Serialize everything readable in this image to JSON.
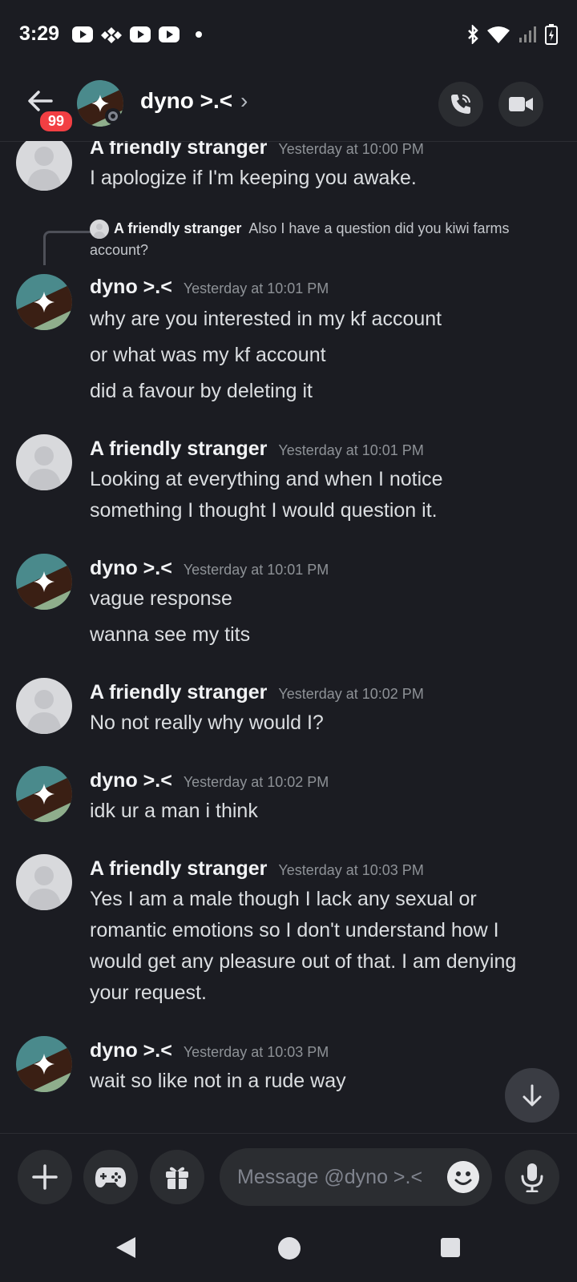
{
  "status_bar": {
    "time": "3:29"
  },
  "header": {
    "back_badge": "99",
    "contact_name": "dyno >.<",
    "chevron": "›"
  },
  "messages": [
    {
      "author": "A friendly stranger",
      "time": "Yesterday at 10:00 PM",
      "lines": [
        "I apologize if I'm keeping you awake."
      ]
    },
    {
      "reply_to": {
        "author": "A friendly stranger",
        "text": "Also I have a question did you kiwi farms account?"
      },
      "author": "dyno >.<",
      "time": "Yesterday at 10:01 PM",
      "lines": [
        "why are you interested in my kf account",
        "or what was my kf account",
        "did a favour by deleting it"
      ]
    },
    {
      "author": "A friendly stranger",
      "time": "Yesterday at 10:01 PM",
      "lines": [
        "Looking at everything and when I notice",
        "something I thought I would question it."
      ]
    },
    {
      "author": "dyno >.<",
      "time": "Yesterday at 10:01 PM",
      "lines": [
        "vague response",
        "wanna see my tits"
      ]
    },
    {
      "author": "A friendly stranger",
      "time": "Yesterday at 10:02 PM",
      "lines": [
        "No not really why would I?"
      ]
    },
    {
      "author": "dyno >.<",
      "time": "Yesterday at 10:02 PM",
      "lines": [
        "idk ur a man i think"
      ]
    },
    {
      "author": "A friendly stranger",
      "time": "Yesterday at 10:03 PM",
      "lines": [
        "Yes I am a male though I lack any sexual or",
        "romantic emotions so I don't understand how I",
        "would get any pleasure out of that. I am denying",
        "your request."
      ]
    },
    {
      "author": "dyno >.<",
      "time": "Yesterday at 10:03 PM",
      "lines": [
        "wait so like not in a rude way"
      ]
    }
  ],
  "composer": {
    "placeholder": "Message @dyno >.<"
  },
  "colors": {
    "background": "#1b1c22",
    "badge": "#f23f43",
    "avatar_teal": "#4a8a8c",
    "avatar_dark": "#3a1f14",
    "avatar_sage": "#8fae8c"
  },
  "icons": [
    "youtube-icon",
    "tidal-icon",
    "bluetooth-icon",
    "wifi-icon",
    "signal-icon",
    "battery-icon",
    "back-arrow-icon",
    "phone-icon",
    "video-camera-icon",
    "arrow-down-icon",
    "plus-icon",
    "gamepad-icon",
    "gift-icon",
    "emoji-icon",
    "microphone-icon",
    "nav-back-icon",
    "nav-home-icon",
    "nav-recents-icon"
  ]
}
